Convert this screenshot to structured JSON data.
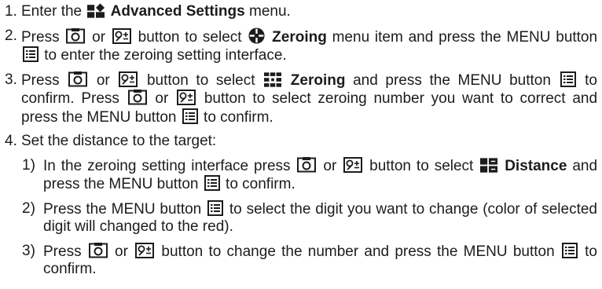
{
  "steps": [
    {
      "num": "1.",
      "t1": "Enter the",
      "b1": "Advanced Settings",
      "t2": "menu."
    },
    {
      "num": "2.",
      "t1": "Press",
      "t2": "or",
      "t3": "button to select",
      "b1": "Zeroing",
      "t4": "menu item and press the MENU button",
      "t5": "to enter the zeroing setting interface."
    },
    {
      "num": "3.",
      "t1": "Press",
      "t2": "or",
      "t3": "button to select",
      "b1": "Zeroing",
      "t4": "and press the MENU button",
      "t5": "to confirm. Press",
      "t6": "or",
      "t7": "button to select zeroing number you want to correct and press the MENU button",
      "t8": "to confirm."
    },
    {
      "num": "4.",
      "t1": "Set the distance to the target:"
    }
  ],
  "substeps": [
    {
      "num": "1)",
      "t1": "In the zeroing setting interface press",
      "t2": "or",
      "t3": "button to select",
      "b1": "Distance",
      "t4": "and press the MENU button",
      "t5": "to confirm."
    },
    {
      "num": "2)",
      "t1": "Press the MENU button",
      "t2": "to select the digit you want to change (color of selected digit will changed to the red)."
    },
    {
      "num": "3)",
      "t1": "Press",
      "t2": "or",
      "t3": "button to change the number and press the MENU button",
      "t4": "to confirm."
    }
  ],
  "icons": {
    "advanced": "advanced-settings-icon",
    "zeroing_menu": "zeroing-crosshair-icon",
    "zeroing_grid": "zeroing-grid-icon",
    "distance": "distance-icon",
    "camera": "camera-button-icon",
    "zoom": "zoom-button-icon",
    "menu": "menu-button-icon"
  }
}
